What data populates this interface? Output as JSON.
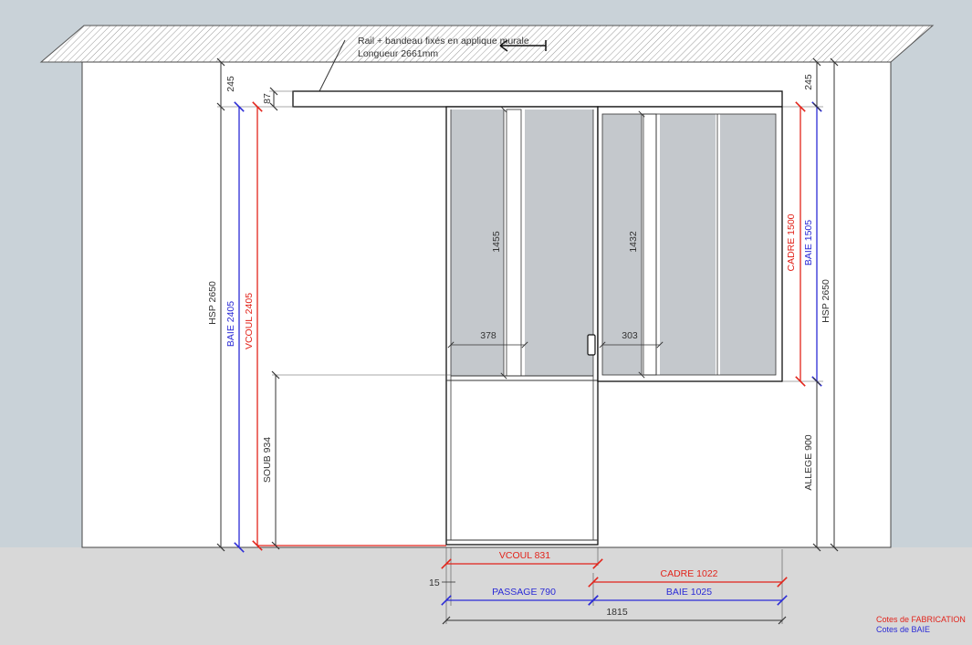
{
  "colors": {
    "background": "#c9d2d8",
    "floor": "#d8d8d8",
    "wall": "#ffffff",
    "glass": "#c4c8cc",
    "frame": "#1a1a1a",
    "fabrication": "#e2231a",
    "baie": "#2b2bd6",
    "dimension": "#444444"
  },
  "note": {
    "line1": "Rail + bandeau fixés en applique murale",
    "line2": "Longueur 2661mm"
  },
  "dimensions": {
    "top_left_245": "245",
    "top_right_245": "245",
    "rail_87": "87",
    "hsp_left": "HSP  2650",
    "baie_left": "BAIE 2405",
    "vcoul_left": "VCOUL 2405",
    "soub": "SOUB 934",
    "door_glass_height": "1455",
    "door_pane_width": "378",
    "verriere_glass_height": "1432",
    "verriere_pane_width": "303",
    "cadre_height": "CADRE 1500",
    "baie_height": "BAIE 1505",
    "hsp_right": "HSP 2650",
    "allege": "ALLEGE 900",
    "vcoul_bottom": "VCOUL 831",
    "gap_15": "15",
    "cadre_width": "CADRE 1022",
    "passage": "PASSAGE 790",
    "baie_width": "BAIE 1025",
    "total_width": "1815"
  },
  "legend": {
    "fabrication": "Cotes de FABRICATION",
    "baie": "Cotes de BAIE"
  }
}
